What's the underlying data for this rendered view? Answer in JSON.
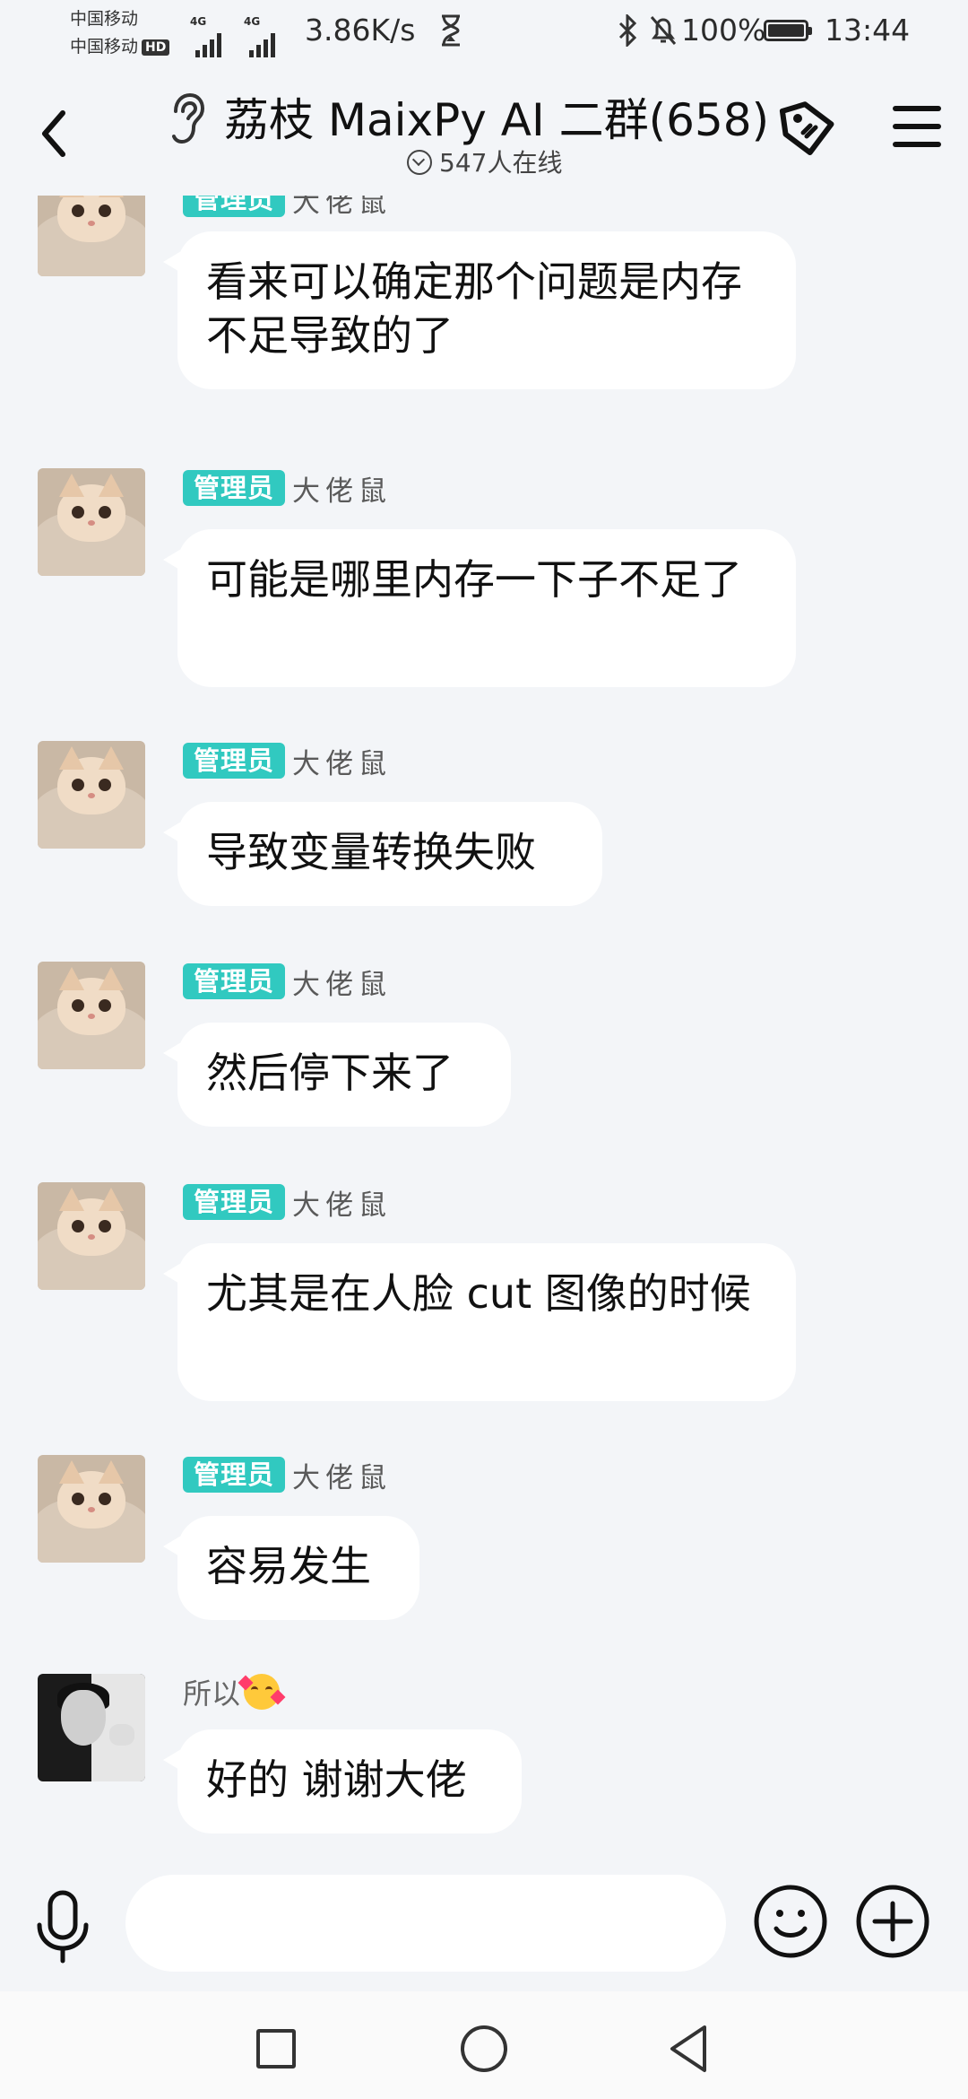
{
  "status_bar": {
    "carrier_1": "中国移动",
    "carrier_2": "中国移动",
    "hd": "HD",
    "net_1": "4G",
    "net_2": "4G",
    "speed": "3.86K/s",
    "battery": "100%",
    "time": "13:44"
  },
  "header": {
    "title": "荔枝 MaixPy AI 二群(658)",
    "online": "547人在线"
  },
  "messages": [
    {
      "badge": "管理员",
      "nick": "大佬鼠",
      "text": "看来可以确定那个问题是内存不足导致的了"
    },
    {
      "badge": "管理员",
      "nick": "大佬鼠",
      "text": "可能是哪里内存一下子不足了"
    },
    {
      "badge": "管理员",
      "nick": "大佬鼠",
      "text": "导致变量转换失败"
    },
    {
      "badge": "管理员",
      "nick": "大佬鼠",
      "text": "然后停下来了"
    },
    {
      "badge": "管理员",
      "nick": "大佬鼠",
      "text": "尤其是在人脸 cut 图像的时候"
    },
    {
      "badge": "管理员",
      "nick": "大佬鼠",
      "text": "容易发生"
    },
    {
      "badge": "",
      "nick": "所以",
      "text": "好的 谢谢大佬"
    }
  ],
  "input": {
    "placeholder": ""
  },
  "icons": [
    "back-icon",
    "ear-icon",
    "tag-icon",
    "menu-icon",
    "mic-icon",
    "smile-icon",
    "plus-icon"
  ]
}
